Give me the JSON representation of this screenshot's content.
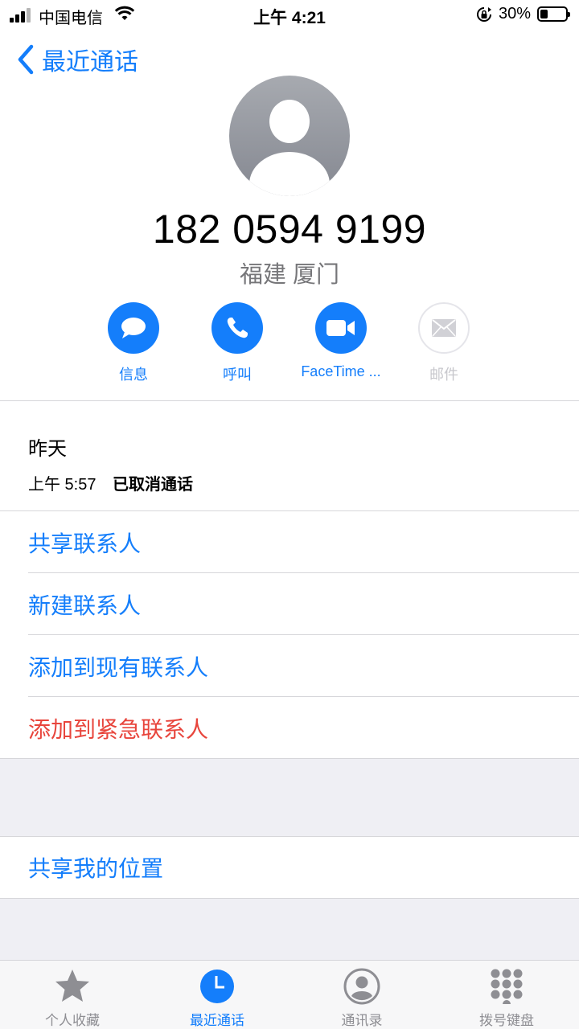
{
  "status_bar": {
    "carrier": "中国电信",
    "time": "上午 4:21",
    "battery_percent": "30%",
    "battery_level": 0.3,
    "icons": [
      "signal-icon",
      "wifi-icon",
      "rotation-lock-icon",
      "battery-icon"
    ]
  },
  "nav": {
    "back_label": "最近通话"
  },
  "contact": {
    "phone_number": "182 0594 9199",
    "location": "福建 厦门"
  },
  "actions": [
    {
      "label": "信息",
      "icon": "message-icon",
      "enabled": true
    },
    {
      "label": "呼叫",
      "icon": "phone-icon",
      "enabled": true
    },
    {
      "label": "FaceTime ...",
      "icon": "video-icon",
      "enabled": true
    },
    {
      "label": "邮件",
      "icon": "mail-icon",
      "enabled": false
    }
  ],
  "recent_call": {
    "day": "昨天",
    "time": "上午 5:57",
    "status": "已取消通话"
  },
  "options": [
    {
      "label": "共享联系人"
    },
    {
      "label": "新建联系人"
    },
    {
      "label": "添加到现有联系人"
    },
    {
      "label": "添加到紧急联系人"
    }
  ],
  "share_location": {
    "label": "共享我的位置"
  },
  "tab_bar": {
    "tabs": [
      {
        "label": "个人收藏",
        "icon": "star-icon",
        "active": false
      },
      {
        "label": "最近通话",
        "icon": "clock-icon",
        "active": true
      },
      {
        "label": "通讯录",
        "icon": "contacts-icon",
        "active": false
      },
      {
        "label": "拨号键盘",
        "icon": "keypad-icon",
        "active": false
      }
    ]
  },
  "colors": {
    "accent": "#147efb",
    "danger": "#e8453c",
    "secondary_text": "#767679",
    "group_background": "#efeff4"
  }
}
